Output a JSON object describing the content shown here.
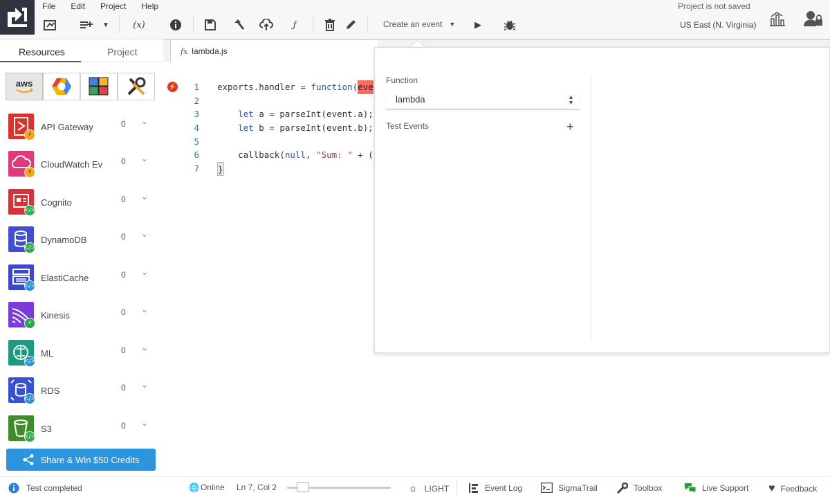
{
  "menu": [
    "File",
    "Edit",
    "Project",
    "Help"
  ],
  "toolbar": {
    "event_select_label": "Create an event",
    "project_status": "Project is not saved",
    "region": "US East (N. Virginia)",
    "variables_label": "(x)"
  },
  "sidebar": {
    "tabs": [
      "Resources",
      "Project"
    ],
    "providers": [
      "aws",
      "gcp",
      "integrations",
      "tools"
    ],
    "resources": [
      {
        "name": "API Gateway",
        "count": "0",
        "color": "#d9342c"
      },
      {
        "name": "CloudWatch Ev",
        "count": "0",
        "color": "#e03a7a"
      },
      {
        "name": "Cognito",
        "count": "0",
        "color": "#d6323a"
      },
      {
        "name": "DynamoDB",
        "count": "0",
        "color": "#3f4fd4"
      },
      {
        "name": "ElastiCache",
        "count": "0",
        "color": "#3a48d0"
      },
      {
        "name": "Kinesis",
        "count": "0",
        "color": "#7a3bd8"
      },
      {
        "name": "ML",
        "count": "0",
        "color": "#1e9a82"
      },
      {
        "name": "RDS",
        "count": "0",
        "color": "#3650d6"
      },
      {
        "name": "S3",
        "count": "0",
        "color": "#3f8c2a"
      }
    ],
    "share_button": "Share & Win $50 Credits"
  },
  "editor": {
    "filename": "lambda.js",
    "line_numbers": [
      "1",
      "2",
      "3",
      "4",
      "5",
      "6",
      "7"
    ],
    "lines": {
      "l1_a": "exports.handler = ",
      "l1_b": "function",
      "l1_c": "(",
      "l1_d": "eve",
      "l3_a": "    ",
      "l3_b": "let",
      "l3_c": " a = parseInt(event.a);",
      "l4_b": "let",
      "l4_c": " b = parseInt(event.b);",
      "l6_a": "    callback(",
      "l6_b": "null",
      "l6_c": ", ",
      "l6_d": "\"Sum: \"",
      "l6_e": " + (",
      "l7": "}"
    }
  },
  "popup": {
    "function_label": "Function",
    "function_value": "lambda",
    "test_events_label": "Test Events"
  },
  "statusbar": {
    "test_status": "Test completed",
    "online": "Online",
    "cursor": "Ln 7, Col 2",
    "theme": "LIGHT",
    "event_log": "Event Log",
    "sigmatrail": "SigmaTrail",
    "toolbox": "Toolbox",
    "live_support": "Live Support",
    "feedback": "Feedback"
  }
}
